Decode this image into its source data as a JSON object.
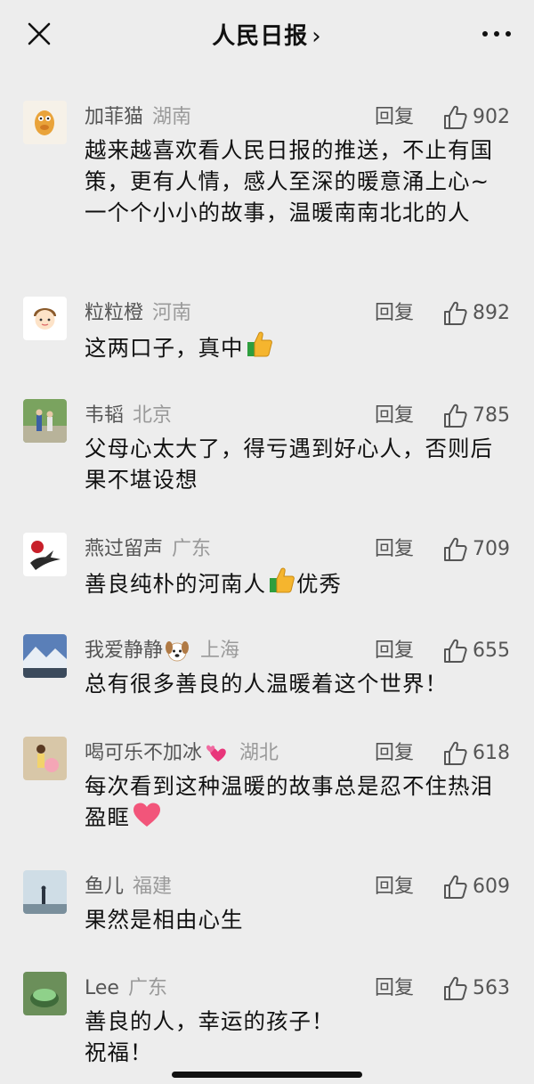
{
  "header": {
    "title": "人民日报",
    "title_chevron": "›"
  },
  "comments": [
    {
      "nickname": "加菲猫",
      "location": "湖南",
      "reply_label": "回复",
      "likes": "902",
      "text": "越来越喜欢看人民日报的推送，不止有国策，更有人情，感人至深的暖意涌上心~ 一个个小小的故事，温暖南南北北的人"
    },
    {
      "nickname": "粒粒橙",
      "location": "河南",
      "reply_label": "回复",
      "likes": "892",
      "text": "这两口子，真中"
    },
    {
      "nickname": "韦韬",
      "location": "北京",
      "reply_label": "回复",
      "likes": "785",
      "text": "父母心太大了，得亏遇到好心人，否则后果不堪设想"
    },
    {
      "nickname": "燕过留声",
      "location": "广东",
      "reply_label": "回复",
      "likes": "709",
      "text_before": "善良纯朴的河南人",
      "text_after": "优秀"
    },
    {
      "nickname": "我爱静静",
      "location": "上海",
      "reply_label": "回复",
      "likes": "655",
      "text": "总有很多善良的人温暖着这个世界！"
    },
    {
      "nickname": "喝可乐不加冰",
      "location": "湖北",
      "reply_label": "回复",
      "likes": "618",
      "text": "每次看到这种温暖的故事总是忍不住热泪盈眶"
    },
    {
      "nickname": "鱼儿",
      "location": "福建",
      "reply_label": "回复",
      "likes": "609",
      "text": "果然是相由心生"
    },
    {
      "nickname": "Lee",
      "location": "广东",
      "reply_label": "回复",
      "likes": "563",
      "text_line1": "善良的人，幸运的孩子！",
      "text_line2": "祝福！"
    }
  ]
}
